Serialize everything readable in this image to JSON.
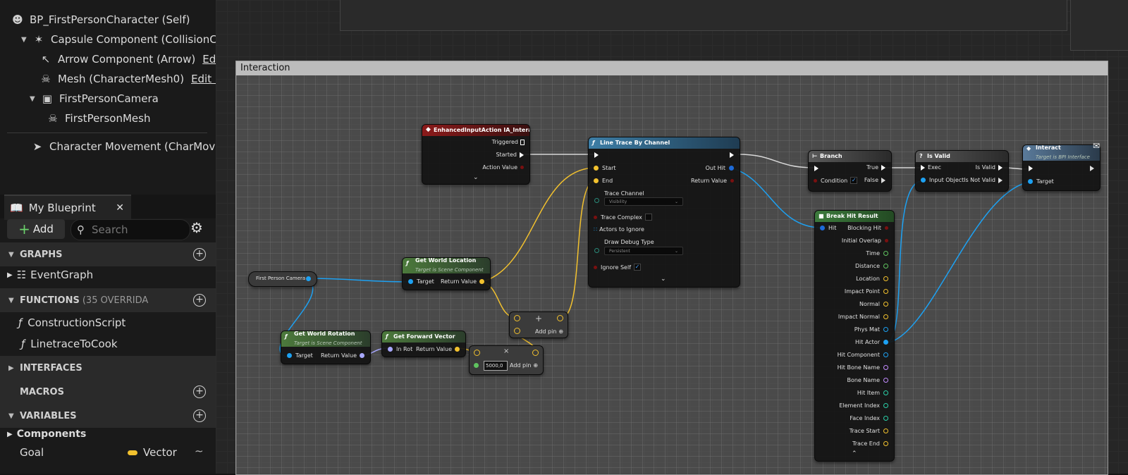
{
  "components": {
    "root": "BP_FirstPersonCharacter (Self)",
    "capsule": "Capsule Component (CollisionCy",
    "arrow": "Arrow Component (Arrow)",
    "arrow_edit": "Edit",
    "mesh": "Mesh (CharacterMesh0)",
    "mesh_edit": "Edit in",
    "camera": "FirstPersonCamera",
    "fpmesh": "FirstPersonMesh",
    "movement": "Character Movement (CharMove"
  },
  "my_blueprint": {
    "tab": "My Blueprint",
    "add": "Add",
    "search_placeholder": "Search",
    "graphs": "GRAPHS",
    "eventgraph": "EventGraph",
    "functions": "FUNCTIONS",
    "functions_count": "(35 OVERRIDA",
    "construction": "ConstructionScript",
    "linetrace": "LinetraceToCook",
    "interfaces": "INTERFACES",
    "macros": "MACROS",
    "variables": "VARIABLES",
    "components_cat": "Components",
    "var_goal": "Goal",
    "var_goal_type": "Vector"
  },
  "colors": {
    "vector": "#f2c12e",
    "object": "#1da1f2",
    "exec": "#ffffff",
    "event": "#8b1a1a",
    "func": "#2a5a7a",
    "pure": "#3f5a3f"
  },
  "graph": {
    "comment": "Interaction",
    "input_event": {
      "title": "EnhancedInputAction IA_Interact",
      "triggered": "Triggered",
      "started": "Started",
      "action_value": "Action Value"
    },
    "camera": "First Person Camera",
    "get_world_location": {
      "title": "Get World Location",
      "sub": "Target is Scene Component",
      "target": "Target",
      "ret": "Return Value"
    },
    "get_world_rotation": {
      "title": "Get World Rotation",
      "sub": "Target is Scene Component",
      "target": "Target",
      "ret": "Return Value"
    },
    "get_forward": {
      "title": "Get Forward Vector",
      "in": "In Rot",
      "ret": "Return Value"
    },
    "add1": {
      "label": "Add pin"
    },
    "mult": {
      "value": "5000,0",
      "label": "Add pin"
    },
    "line_trace": {
      "title": "Line Trace By Channel",
      "start": "Start",
      "end": "End",
      "out_hit": "Out Hit",
      "ret": "Return Value",
      "trace_channel": "Trace Channel",
      "trace_channel_val": "Visibility",
      "trace_complex": "Trace Complex",
      "actors_ignore": "Actors to Ignore",
      "draw_debug": "Draw Debug Type",
      "draw_debug_val": "Persistent",
      "ignore_self": "Ignore Self"
    },
    "branch": {
      "title": "Branch",
      "condition": "Condition",
      "true": "True",
      "false": "False"
    },
    "is_valid": {
      "title": "Is Valid",
      "exec": "Exec",
      "input": "Input Object",
      "valid": "Is Valid",
      "not_valid": "Is Not Valid"
    },
    "interact": {
      "title": "Interact",
      "sub": "Target is BPI Interface",
      "target": "Target"
    },
    "break_hit": {
      "title": "Break Hit Result",
      "hit": "Hit",
      "pins": [
        "Blocking Hit",
        "Initial Overlap",
        "Time",
        "Distance",
        "Location",
        "Impact Point",
        "Normal",
        "Impact Normal",
        "Phys Mat",
        "Hit Actor",
        "Hit Component",
        "Hit Bone Name",
        "Bone Name",
        "Hit Item",
        "Element Index",
        "Face Index",
        "Trace Start",
        "Trace End"
      ]
    }
  }
}
